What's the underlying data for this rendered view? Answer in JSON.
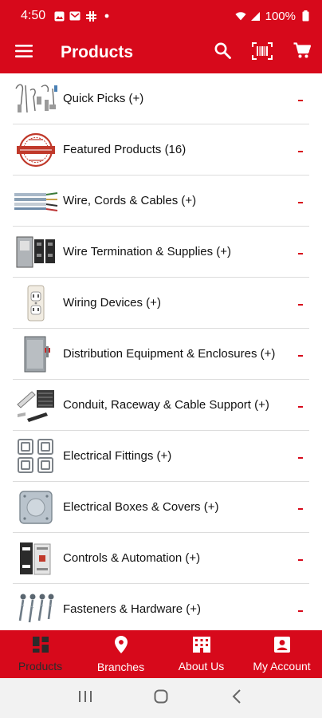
{
  "status_bar": {
    "time": "4:50",
    "battery": "100%"
  },
  "app_bar": {
    "title": "Products",
    "icons": [
      "menu-icon",
      "search-icon",
      "barcode-scan-icon",
      "cart-icon"
    ]
  },
  "products": {
    "items": [
      {
        "label": "Quick Picks (+)",
        "icon": "quick-picks-thumbnail"
      },
      {
        "label": "Featured Products (16)",
        "icon": "featured-products-seal"
      },
      {
        "label": "Wire, Cords & Cables (+)",
        "icon": "wire-cables-thumbnail"
      },
      {
        "label": "Wire Termination & Supplies  (+)",
        "icon": "wire-termination-thumbnail"
      },
      {
        "label": "Wiring Devices (+)",
        "icon": "wiring-device-thumbnail"
      },
      {
        "label": "Distribution Equipment & Enclosures (+)",
        "icon": "distribution-equipment-thumbnail"
      },
      {
        "label": "Conduit, Raceway & Cable Support (+)",
        "icon": "conduit-thumbnail"
      },
      {
        "label": "Electrical Fittings (+)",
        "icon": "electrical-fittings-thumbnail"
      },
      {
        "label": "Electrical Boxes & Covers (+)",
        "icon": "electrical-boxes-thumbnail"
      },
      {
        "label": "Controls & Automation (+)",
        "icon": "controls-thumbnail"
      },
      {
        "label": "Fasteners & Hardware (+)",
        "icon": "fasteners-thumbnail"
      }
    ]
  },
  "bottom_nav": {
    "items": [
      {
        "label": "Products",
        "icon": "products-grid-icon",
        "active": true
      },
      {
        "label": "Branches",
        "icon": "location-pin-icon",
        "active": false
      },
      {
        "label": "About Us",
        "icon": "building-icon",
        "active": false
      },
      {
        "label": "My Account",
        "icon": "account-icon",
        "active": false
      }
    ]
  },
  "colors": {
    "brand_red": "#d7091b",
    "divider": "#dcdcdc",
    "active_nav_text": "#2b2b2b"
  }
}
